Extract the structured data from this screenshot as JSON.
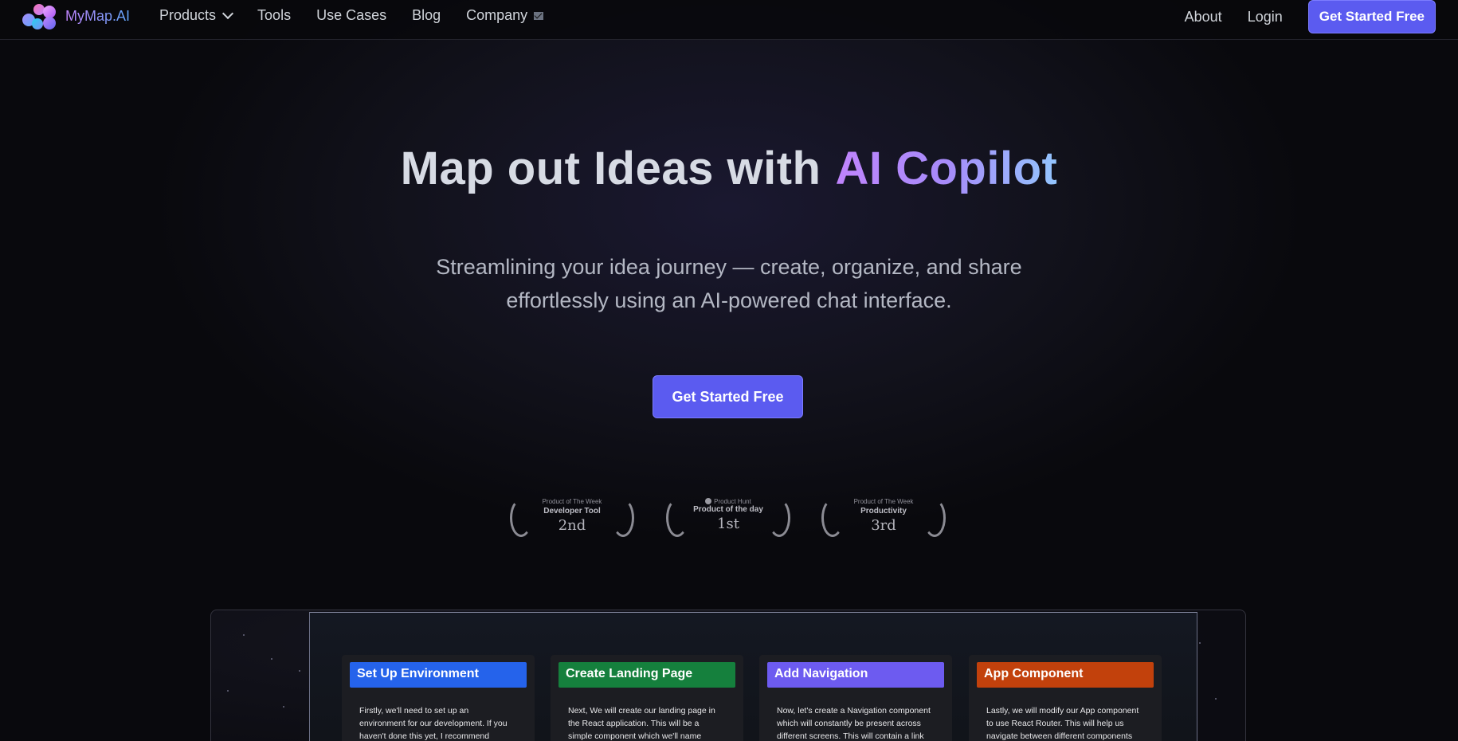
{
  "nav": {
    "logo_text": "MyMap.AI",
    "links": [
      "Products",
      "Tools",
      "Use Cases",
      "Blog",
      "Company"
    ],
    "right_links": [
      "About",
      "Login"
    ],
    "cta": "Get Started Free"
  },
  "hero": {
    "title_plain": "Map out Ideas with",
    "title_accent": "AI Copilot",
    "subtitle_line1": "Streamlining your idea journey — create, organize, and share",
    "subtitle_line2": "effortlessly using an AI-powered chat interface.",
    "cta": "Get Started Free"
  },
  "badges": [
    {
      "top": "Product of The Week",
      "category": "Developer Tool",
      "rank": "2nd"
    },
    {
      "top": "Product Hunt",
      "category": "Product of the day",
      "rank": "1st"
    },
    {
      "top": "Product of The Week",
      "category": "Productivity",
      "rank": "3rd"
    }
  ],
  "cards": [
    {
      "title": "Set Up Environment",
      "color": "#2563eb",
      "line1": "Firstly, we'll need to set up an",
      "line2": "environment for our development. If you",
      "line3": "haven't done this yet, I recommend"
    },
    {
      "title": "Create Landing Page",
      "color": "#15803d",
      "line1": "Next, We will create our landing page in",
      "line2": "the React application. This will be a",
      "line3": "simple component which we'll name"
    },
    {
      "title": "Add Navigation",
      "color": "#6d5bf0",
      "line1": "Now, let's create a Navigation component",
      "line2": "which will constantly be present across",
      "line3": "different screens. This will contain a link"
    },
    {
      "title": "App Component",
      "color": "#c2410c",
      "line1": "Lastly, we will modify our App component",
      "line2": "to use React Router. This will help us",
      "line3": "navigate between different components"
    }
  ]
}
